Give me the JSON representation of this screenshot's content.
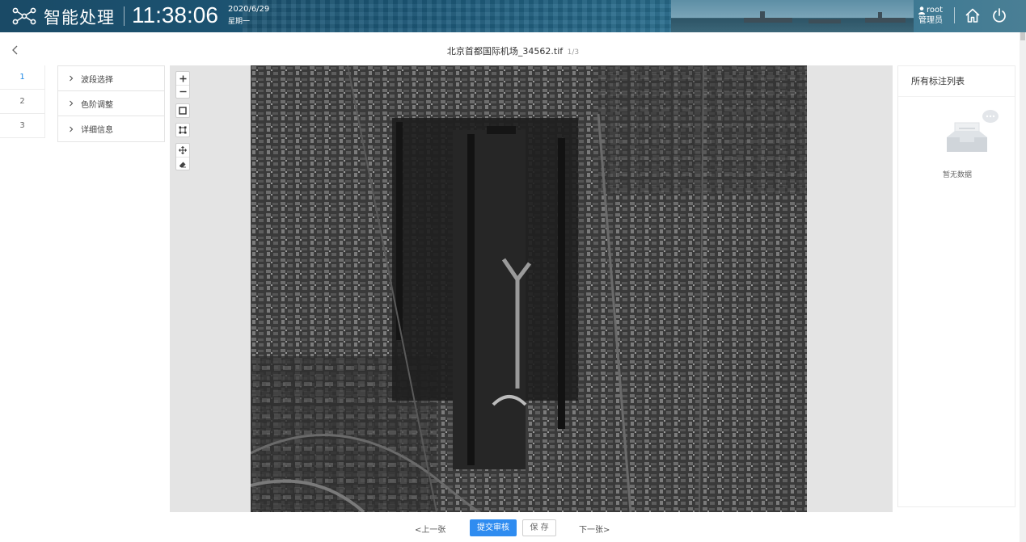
{
  "header": {
    "app_title": "智能处理",
    "time": "11:38:06",
    "date": "2020/6/29",
    "weekday": "星期一",
    "user": {
      "name": "root",
      "role": "管理员"
    },
    "icons": [
      "logo-icon",
      "user-icon",
      "home-icon",
      "power-icon"
    ]
  },
  "titlebar": {
    "file_name": "北京首都国际机场_34562.tif",
    "page_indicator": "1/3"
  },
  "pages": [
    "1",
    "2",
    "3"
  ],
  "active_page": "1",
  "panels": [
    {
      "label": "波段选择"
    },
    {
      "label": "色阶调整"
    },
    {
      "label": "详细信息"
    }
  ],
  "viewer": {
    "tools": [
      "zoom-in-icon",
      "zoom-out-icon",
      "rectangle-icon",
      "polygon-icon",
      "pan-icon",
      "eraser-icon"
    ]
  },
  "annotations": {
    "title": "所有标注列表",
    "empty_text": "暂无数据"
  },
  "bottom": {
    "prev_label": "<上一张",
    "submit_label": "提交审核",
    "save_label": "保 存",
    "next_label": "下一张>"
  },
  "colors": {
    "accent": "#2f8cf0",
    "header_bg": "#1d5a7a",
    "viewer_bg": "#e4e4e4"
  }
}
